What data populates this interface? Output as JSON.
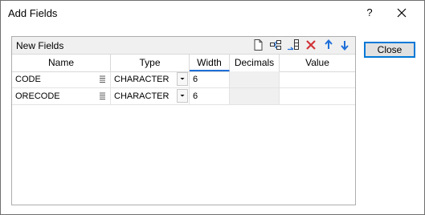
{
  "window": {
    "title": "Add Fields",
    "help_label": "?"
  },
  "panel": {
    "title": "New Fields"
  },
  "toolbar": {
    "icons": [
      "new-document-icon",
      "insert-field-icon",
      "add-field-icon",
      "delete-icon",
      "move-up-icon",
      "move-down-icon"
    ],
    "delete_color": "#d13438",
    "arrow_color": "#1e6fd9"
  },
  "columns": [
    "Name",
    "Type",
    "Width",
    "Decimals",
    "Value"
  ],
  "rows": [
    {
      "name": "CODE",
      "type": "CHARACTER",
      "width": "6",
      "decimals": "",
      "value": ""
    },
    {
      "name": "ORECODE",
      "type": "CHARACTER",
      "width": "6",
      "decimals": "",
      "value": ""
    }
  ],
  "buttons": {
    "close": "Close"
  }
}
